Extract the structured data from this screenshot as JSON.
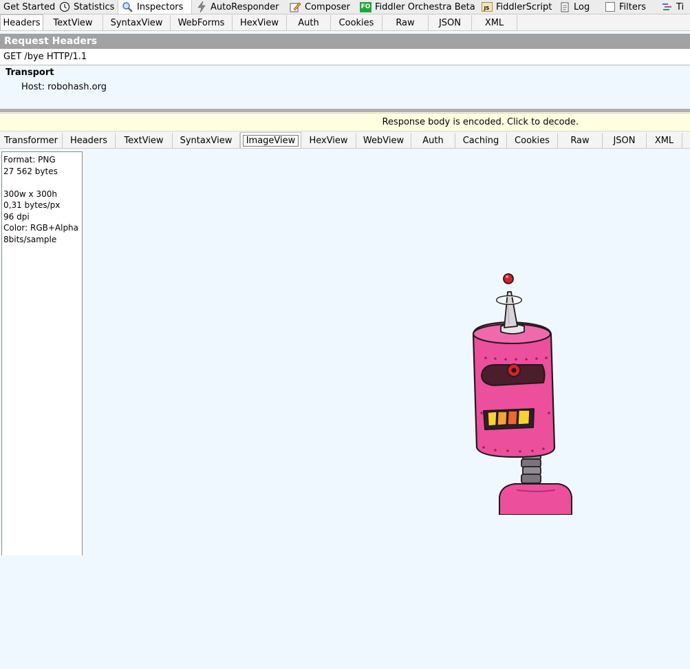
{
  "top_tabs": [
    {
      "label": "Get Started",
      "icon": "none"
    },
    {
      "label": "Statistics",
      "icon": "clock-icon"
    },
    {
      "label": "Inspectors",
      "icon": "magnifier-icon",
      "active": true
    },
    {
      "label": "AutoResponder",
      "icon": "lightning-icon"
    },
    {
      "label": "Composer",
      "icon": "compose-icon"
    },
    {
      "label": "Fiddler Orchestra Beta",
      "icon": "fo-icon",
      "badge": "FO"
    },
    {
      "label": "FiddlerScript",
      "icon": "script-icon",
      "badge": "JS"
    },
    {
      "label": "Log",
      "icon": "log-icon"
    },
    {
      "label": "Filters",
      "icon": "checkbox-icon"
    },
    {
      "label": "Ti",
      "icon": "timeline-icon"
    }
  ],
  "request": {
    "tabs": [
      "Headers",
      "TextView",
      "SyntaxView",
      "WebForms",
      "HexView",
      "Auth",
      "Cookies",
      "Raw",
      "JSON",
      "XML"
    ],
    "active_tab": "Headers",
    "header_title": "Request Headers",
    "request_line": "GET /bye HTTP/1.1",
    "group": "Transport",
    "host": "Host: robohash.org"
  },
  "response": {
    "encoded_notice": "Response body is encoded. Click to decode.",
    "tabs": [
      "Transformer",
      "Headers",
      "TextView",
      "SyntaxView",
      "ImageView",
      "HexView",
      "WebView",
      "Auth",
      "Caching",
      "Cookies",
      "Raw",
      "JSON",
      "XML"
    ],
    "active_tab": "ImageView",
    "image_info": [
      "Format: PNG",
      "27 562 bytes",
      "",
      "300w x 300h",
      "0,31 bytes/px",
      "96 dpi",
      "Color: RGB+Alpha",
      "8bits/sample"
    ]
  },
  "colors": {
    "robot_body": "#ec4f9c",
    "robot_outline": "#1f1a1d",
    "panel_bg": "#f0f8ff",
    "header_bar": "#a2a2a2",
    "notice_bg": "#ffffe1"
  }
}
